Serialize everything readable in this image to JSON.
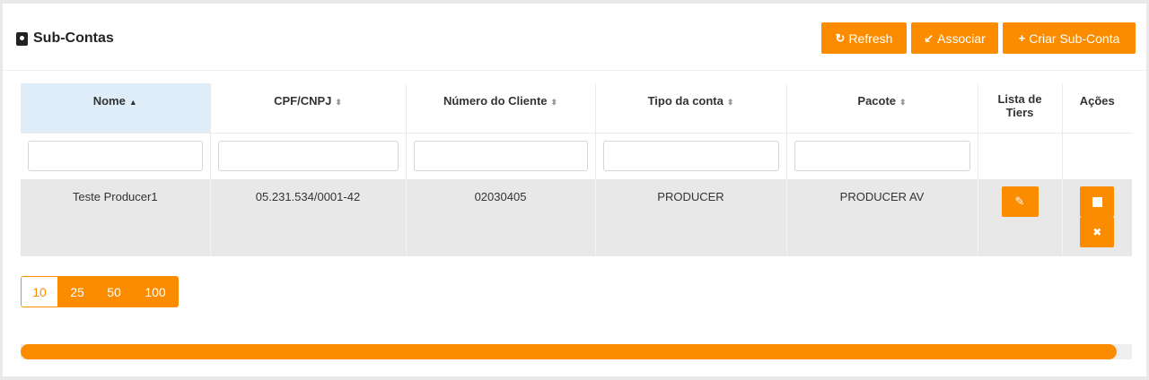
{
  "header": {
    "title": "Sub-Contas",
    "buttons": {
      "refresh": {
        "icon": "refresh-icon",
        "label": "Refresh"
      },
      "associar": {
        "icon": "compress-icon",
        "label": "Associar"
      },
      "criar": {
        "icon": "plus-icon",
        "label": "Criar Sub-Conta"
      }
    }
  },
  "table": {
    "columns": [
      {
        "label": "Nome",
        "sort": "asc"
      },
      {
        "label": "CPF/CNPJ",
        "sort": "none"
      },
      {
        "label": "Número do Cliente",
        "sort": "none"
      },
      {
        "label": "Tipo da conta",
        "sort": "none"
      },
      {
        "label": "Pacote",
        "sort": "none"
      },
      {
        "label": "Lista de Tiers",
        "sort": ""
      },
      {
        "label": "Ações",
        "sort": ""
      }
    ],
    "rows": [
      {
        "nome": "Teste Producer1",
        "cpf_cnpj": "05.231.534/0001-42",
        "numero_cliente": "02030405",
        "tipo_conta": "PRODUCER",
        "pacote": "PRODUCER AV"
      }
    ]
  },
  "pagination": {
    "page_sizes": [
      "10",
      "25",
      "50",
      "100"
    ],
    "selected": "10"
  },
  "colors": {
    "accent": "#fb8c00",
    "sorted_header": "#deedf7",
    "row_bg": "#e8e8e8"
  }
}
